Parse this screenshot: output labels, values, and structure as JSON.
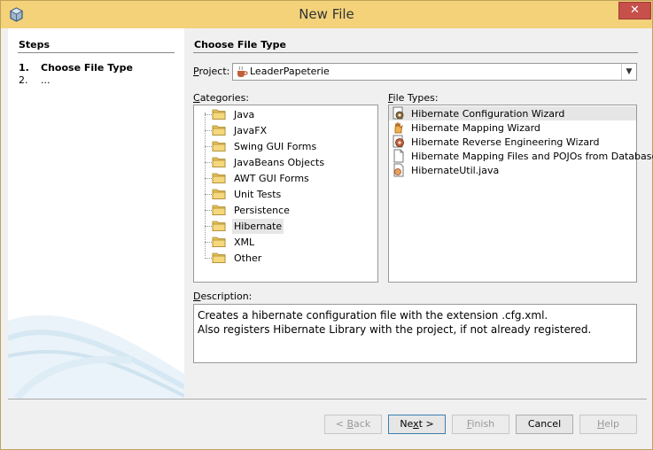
{
  "window": {
    "title": "New File"
  },
  "steps": {
    "heading": "Steps",
    "items": [
      {
        "num": "1.",
        "label": "Choose File Type"
      },
      {
        "num": "2.",
        "label": "..."
      }
    ]
  },
  "main": {
    "heading": "Choose File Type",
    "project_label": "Project:",
    "project_value": "LeaderPapeterie",
    "categories_label": "Categories:",
    "categories": [
      "Java",
      "JavaFX",
      "Swing GUI Forms",
      "JavaBeans Objects",
      "AWT GUI Forms",
      "Unit Tests",
      "Persistence",
      "Hibernate",
      "XML",
      "Other"
    ],
    "selected_category": "Hibernate",
    "file_types_label": "File Types:",
    "file_types": [
      {
        "label": "Hibernate Configuration Wizard",
        "icon": "hibernate-config-icon"
      },
      {
        "label": "Hibernate Mapping Wizard",
        "icon": "hibernate-mapping-icon"
      },
      {
        "label": "Hibernate Reverse Engineering Wizard",
        "icon": "hibernate-reveng-icon"
      },
      {
        "label": "Hibernate Mapping Files and POJOs from Database",
        "icon": "document-icon"
      },
      {
        "label": "HibernateUtil.java",
        "icon": "java-class-icon"
      }
    ],
    "description_label": "Description:",
    "description_lines": [
      "Creates a hibernate configuration file with the extension .cfg.xml.",
      "Also registers Hibernate Library with the project, if not already registered."
    ]
  },
  "buttons": {
    "back": "< Back",
    "next": "Next >",
    "finish": "Finish",
    "cancel": "Cancel",
    "help": "Help"
  },
  "colors": {
    "titlebar": "#f3d27a",
    "close": "#c7504a",
    "selection": "#e6e6e6"
  }
}
